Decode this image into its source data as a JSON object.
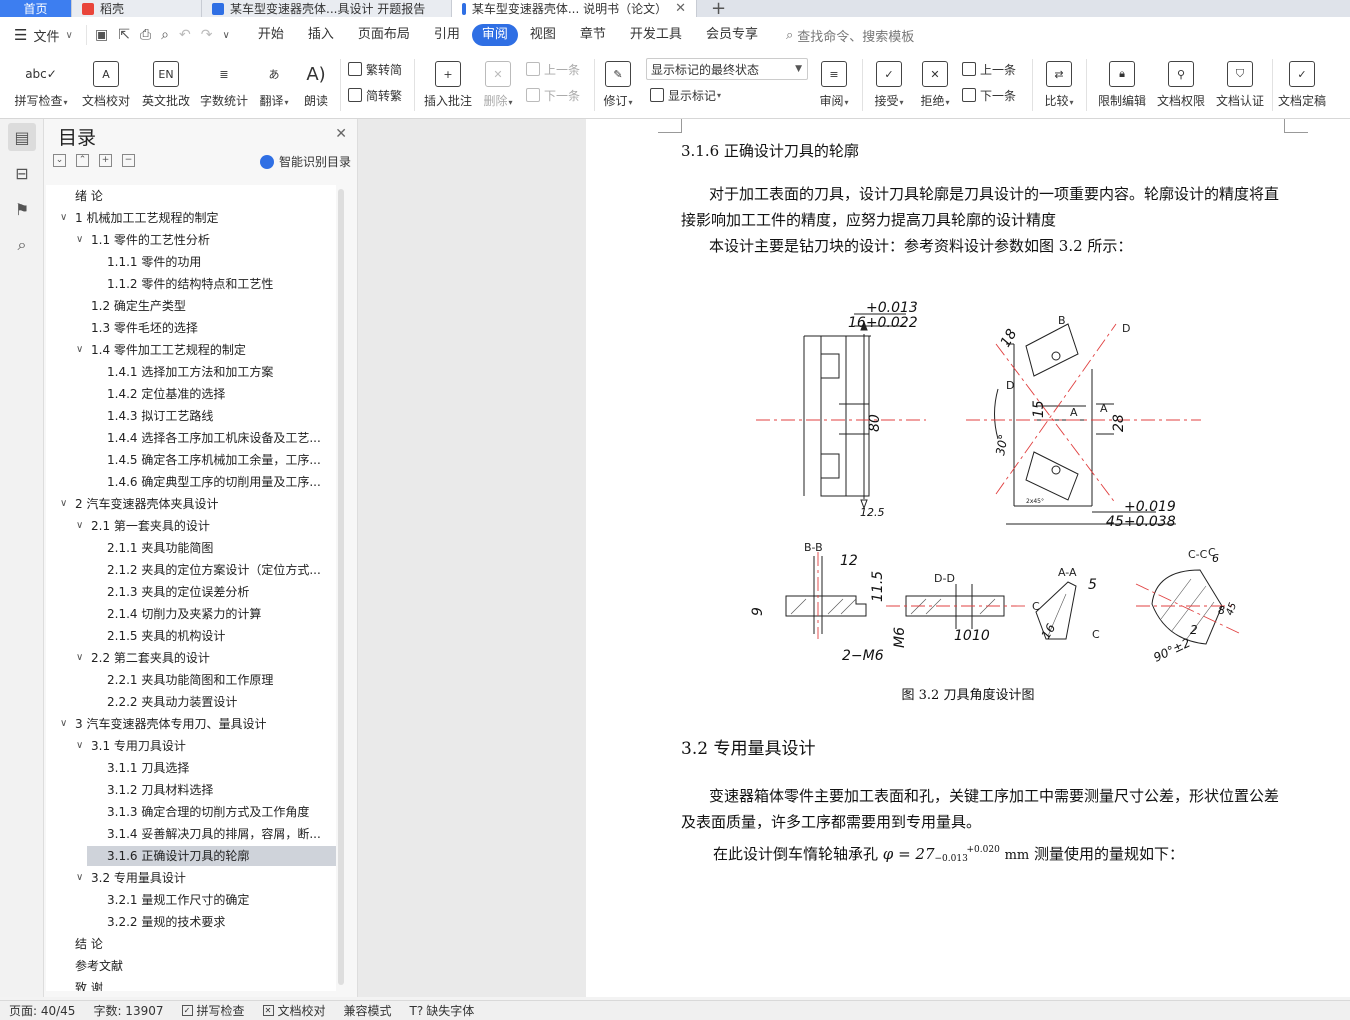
{
  "tabs": [
    {
      "label": "首页"
    },
    {
      "label": "稻壳"
    },
    {
      "label": "某车型变速器壳体...具设计 开题报告"
    },
    {
      "label": "某车型变速器壳体... 说明书（论文）"
    }
  ],
  "menu": {
    "file": "文件",
    "items": [
      "开始",
      "插入",
      "页面布局",
      "引用",
      "审阅",
      "视图",
      "章节",
      "开发工具",
      "会员专享"
    ],
    "search": "查找命令、搜索模板"
  },
  "ribbon": {
    "spell": "拼写检查",
    "proof": "文档校对",
    "eng": "英文批改",
    "count": "字数统计",
    "translate": "翻译",
    "read": "朗读",
    "trad": "繁转简",
    "simp": "简转繁",
    "insert_comment": "插入批注",
    "delete": "删除",
    "prev": "上一条",
    "next": "下一条",
    "revise": "修订",
    "markup_state": "显示标记的最终状态",
    "show_markup": "显示标记",
    "review": "审阅",
    "accept": "接受",
    "reject": "拒绝",
    "prev2": "上一条",
    "next2": "下一条",
    "compare": "比较",
    "restrict": "限制编辑",
    "perm": "文档权限",
    "auth": "文档认证",
    "final": "文档定稿"
  },
  "toc": {
    "title": "目录",
    "ai": "智能识别目录",
    "items": [
      {
        "label": "绪  论",
        "lvl": 0,
        "chev": false
      },
      {
        "label": "1  机械加工工艺规程的制定",
        "lvl": 0,
        "chev": true
      },
      {
        "label": "1.1  零件的工艺性分析",
        "lvl": 1,
        "chev": true
      },
      {
        "label": "1.1.1  零件的功用",
        "lvl": 2,
        "chev": false
      },
      {
        "label": "1.1.2  零件的结构特点和工艺性",
        "lvl": 2,
        "chev": false
      },
      {
        "label": "1.2  确定生产类型",
        "lvl": 1,
        "chev": false
      },
      {
        "label": "1.3  零件毛坯的选择",
        "lvl": 1,
        "chev": false
      },
      {
        "label": "1.4  零件加工工艺规程的制定",
        "lvl": 1,
        "chev": true
      },
      {
        "label": "1.4.1  选择加工方法和加工方案",
        "lvl": 2,
        "chev": false
      },
      {
        "label": "1.4.2  定位基准的选择",
        "lvl": 2,
        "chev": false
      },
      {
        "label": "1.4.3  拟订工艺路线",
        "lvl": 2,
        "chev": false
      },
      {
        "label": "1.4.4  选择各工序加工机床设备及工艺...",
        "lvl": 2,
        "chev": false
      },
      {
        "label": "1.4.5  确定各工序机械加工余量，工序...",
        "lvl": 2,
        "chev": false
      },
      {
        "label": "1.4.6  确定典型工序的切削用量及工序...",
        "lvl": 2,
        "chev": false
      },
      {
        "label": "2  汽车变速器壳体夹具设计",
        "lvl": 0,
        "chev": true
      },
      {
        "label": "2.1  第一套夹具的设计",
        "lvl": 1,
        "chev": true
      },
      {
        "label": "2.1.1  夹具功能简图",
        "lvl": 2,
        "chev": false
      },
      {
        "label": "2.1.2  夹具的定位方案设计（定位方式...",
        "lvl": 2,
        "chev": false
      },
      {
        "label": "2.1.3  夹具的定位误差分析",
        "lvl": 2,
        "chev": false
      },
      {
        "label": "2.1.4  切削力及夹紧力的计算",
        "lvl": 2,
        "chev": false
      },
      {
        "label": "2.1.5  夹具的机构设计",
        "lvl": 2,
        "chev": false
      },
      {
        "label": "2.2  第二套夹具的设计",
        "lvl": 1,
        "chev": true
      },
      {
        "label": "2.2.1  夹具功能简图和工作原理",
        "lvl": 2,
        "chev": false
      },
      {
        "label": "2.2.2  夹具动力装置设计",
        "lvl": 2,
        "chev": false
      },
      {
        "label": "3  汽车变速器壳体专用刀、量具设计",
        "lvl": 0,
        "chev": true
      },
      {
        "label": "3.1  专用刀具设计",
        "lvl": 1,
        "chev": true
      },
      {
        "label": "3.1.1  刀具选择",
        "lvl": 2,
        "chev": false
      },
      {
        "label": "3.1.2  刀具材料选择",
        "lvl": 2,
        "chev": false
      },
      {
        "label": "3.1.3  确定合理的切削方式及工作角度",
        "lvl": 2,
        "chev": false
      },
      {
        "label": "3.1.4  妥善解决刀具的排屑，容屑，断...",
        "lvl": 2,
        "chev": false
      },
      {
        "label": "3.1.6  正确设计刀具的轮廓",
        "lvl": 2,
        "chev": false,
        "selected": true
      },
      {
        "label": "3.2  专用量具设计",
        "lvl": 1,
        "chev": true
      },
      {
        "label": "3.2.1  量规工作尺寸的确定",
        "lvl": 2,
        "chev": false
      },
      {
        "label": "3.2.2  量规的技术要求",
        "lvl": 2,
        "chev": false
      },
      {
        "label": "结  论",
        "lvl": 0,
        "chev": false
      },
      {
        "label": "参考文献",
        "lvl": 0,
        "chev": false
      },
      {
        "label": "致  谢",
        "lvl": 0,
        "chev": false
      }
    ]
  },
  "doc": {
    "h316": "3.1.6  正确设计刀具的轮廓",
    "p1": "对于加工表面的刀具，设计刀具轮廓是刀具设计的一项重要内容。轮廓设计的精度将直接影响加工工件的精度，应努力提高刀具轮廓的设计精度",
    "p2": "本设计主要是钻刀块的设计：参考资料设计参数如图 3.2 所示：",
    "caption": "图 3.2 刀具角度设计图",
    "h32": "3.2  专用量具设计",
    "p3": "变速器箱体零件主要加工表面和孔，关键工序加工中需要测量尺寸公差，形状位置公差及表面质量，许多工序都需要用到专用量具。",
    "p4_pre": "在此设计倒车惰轮轴承孔",
    "p4_formula": "φ = 27",
    "p4_sup": "+0.020",
    "p4_sub": "−0.013",
    "p4_unit": "mm",
    "p4_post": "测量使用的量规如下："
  },
  "drawing": {
    "d1": "+0.013",
    "d2": "16+0.022",
    "d3": "80",
    "d4": "12.5",
    "d5": "18",
    "d6": "15",
    "d7": "28",
    "d8": "+0.019",
    "d9": "45+0.038",
    "d10": "30°",
    "d11": "12",
    "d12": "11.5",
    "d13": "9",
    "d14": "2−M6",
    "d15": "M6",
    "d16": "10",
    "d17": "10",
    "d18": "5",
    "d19": "16",
    "d20": "90°±2",
    "d21": "2",
    "d22": "6",
    "d23": "8",
    "d24": "45",
    "lbB1": "B",
    "lbD1": "D",
    "lbD2": "D",
    "lbA1": "A",
    "lbA2": "A",
    "vBB": "B-B",
    "vDD": "D-D",
    "vAA": "A-A",
    "vCC": "C-C",
    "lbC1": "C",
    "lbC2": "C",
    "lbC3": "C",
    "chamf": "2x45°"
  },
  "status": {
    "page": "页面: 40/45",
    "words": "字数: 13907",
    "spell": "拼写检查",
    "proof": "文档校对",
    "compat": "兼容模式",
    "missing_font": "缺失字体"
  }
}
